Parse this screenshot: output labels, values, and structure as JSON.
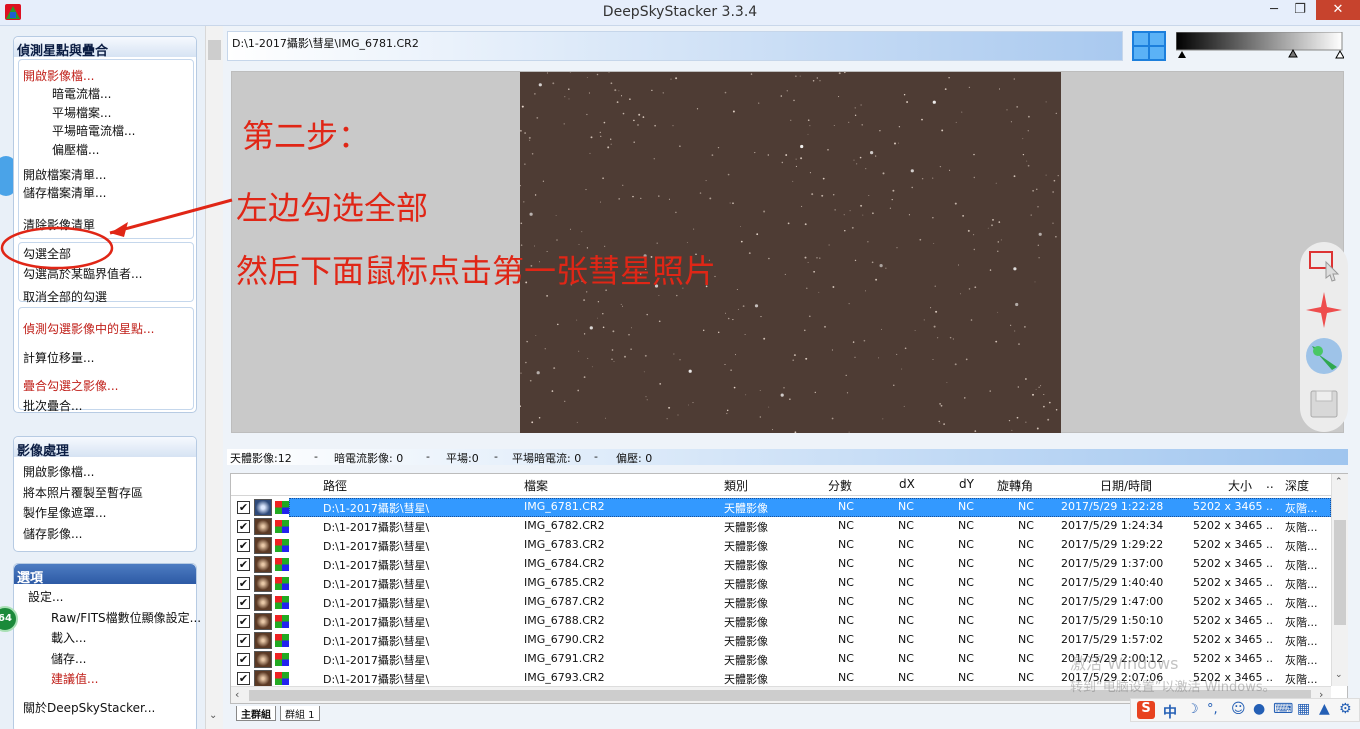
{
  "window": {
    "title": "DeepSkyStacker 3.3.4",
    "min": "─",
    "max": "❐",
    "close": "✕"
  },
  "left": {
    "group1": {
      "header": "偵測星點與疊合",
      "items": [
        {
          "label": "開啟影像檔...",
          "red": true
        },
        {
          "label": "暗電流檔..."
        },
        {
          "label": "平場檔案..."
        },
        {
          "label": "平場暗電流檔..."
        },
        {
          "label": "偏壓檔..."
        },
        {
          "label": "開啟檔案清單..."
        },
        {
          "label": "儲存檔案清單..."
        },
        {
          "label": "清除影像清單"
        },
        {
          "label": "勾選全部"
        },
        {
          "label": "勾選高於某臨界值者..."
        },
        {
          "label": "取消全部的勾選"
        },
        {
          "label": "偵測勾選影像中的星點...",
          "red": true
        },
        {
          "label": "計算位移量..."
        },
        {
          "label": "疊合勾選之影像...",
          "red": true
        },
        {
          "label": "批次疊合..."
        }
      ]
    },
    "group2": {
      "header": "影像處理",
      "items": [
        "開啟影像檔...",
        "將本照片覆製至暫存區",
        "製作星像遮罩...",
        "儲存影像..."
      ]
    },
    "group3": {
      "header": "選項",
      "items": [
        {
          "label": "設定..."
        },
        {
          "label": "Raw/FITS檔數位顯像設定..."
        },
        {
          "label": "載入..."
        },
        {
          "label": "儲存..."
        },
        {
          "label": "建議值...",
          "red": true
        },
        {
          "label": "關於DeepSkyStacker..."
        }
      ],
      "badge": "64"
    }
  },
  "viewer": {
    "path": "D:\\1-2017攝影\\彗星\\IMG_6781.CR2"
  },
  "annotations": {
    "step": "第二步：",
    "line1": "左边勾选全部",
    "line2": "然后下面鼠标点击第一张彗星照片"
  },
  "status": {
    "light": "天體影像:12",
    "dark": "暗電流影像: 0",
    "flat": "平場:0",
    "darkflat": "平場暗電流: 0",
    "bias": "偏壓: 0",
    "sep": "-"
  },
  "table": {
    "headers": {
      "path": "路徑",
      "file": "檔案",
      "type": "類別",
      "score": "分數",
      "dx": "dX",
      "dy": "dY",
      "angle": "旋轉角",
      "date": "日期/時間",
      "size": "大小",
      "cfa": "..",
      "depth": "深度"
    },
    "rows": [
      {
        "path": "D:\\1-2017攝影\\彗星\\",
        "file": "IMG_6781.CR2",
        "type": "天體影像",
        "score": "NC",
        "dx": "NC",
        "dy": "NC",
        "angle": "NC",
        "date": "2017/5/29 1:22:28",
        "size": "5202 x 3465",
        "cfa": "..",
        "depth": "灰階..."
      },
      {
        "path": "D:\\1-2017攝影\\彗星\\",
        "file": "IMG_6782.CR2",
        "type": "天體影像",
        "score": "NC",
        "dx": "NC",
        "dy": "NC",
        "angle": "NC",
        "date": "2017/5/29 1:24:34",
        "size": "5202 x 3465",
        "cfa": "..",
        "depth": "灰階..."
      },
      {
        "path": "D:\\1-2017攝影\\彗星\\",
        "file": "IMG_6783.CR2",
        "type": "天體影像",
        "score": "NC",
        "dx": "NC",
        "dy": "NC",
        "angle": "NC",
        "date": "2017/5/29 1:29:22",
        "size": "5202 x 3465",
        "cfa": "..",
        "depth": "灰階..."
      },
      {
        "path": "D:\\1-2017攝影\\彗星\\",
        "file": "IMG_6784.CR2",
        "type": "天體影像",
        "score": "NC",
        "dx": "NC",
        "dy": "NC",
        "angle": "NC",
        "date": "2017/5/29 1:37:00",
        "size": "5202 x 3465",
        "cfa": "..",
        "depth": "灰階..."
      },
      {
        "path": "D:\\1-2017攝影\\彗星\\",
        "file": "IMG_6785.CR2",
        "type": "天體影像",
        "score": "NC",
        "dx": "NC",
        "dy": "NC",
        "angle": "NC",
        "date": "2017/5/29 1:40:40",
        "size": "5202 x 3465",
        "cfa": "..",
        "depth": "灰階..."
      },
      {
        "path": "D:\\1-2017攝影\\彗星\\",
        "file": "IMG_6787.CR2",
        "type": "天體影像",
        "score": "NC",
        "dx": "NC",
        "dy": "NC",
        "angle": "NC",
        "date": "2017/5/29 1:47:00",
        "size": "5202 x 3465",
        "cfa": "..",
        "depth": "灰階..."
      },
      {
        "path": "D:\\1-2017攝影\\彗星\\",
        "file": "IMG_6788.CR2",
        "type": "天體影像",
        "score": "NC",
        "dx": "NC",
        "dy": "NC",
        "angle": "NC",
        "date": "2017/5/29 1:50:10",
        "size": "5202 x 3465",
        "cfa": "..",
        "depth": "灰階..."
      },
      {
        "path": "D:\\1-2017攝影\\彗星\\",
        "file": "IMG_6790.CR2",
        "type": "天體影像",
        "score": "NC",
        "dx": "NC",
        "dy": "NC",
        "angle": "NC",
        "date": "2017/5/29 1:57:02",
        "size": "5202 x 3465",
        "cfa": "..",
        "depth": "灰階..."
      },
      {
        "path": "D:\\1-2017攝影\\彗星\\",
        "file": "IMG_6791.CR2",
        "type": "天體影像",
        "score": "NC",
        "dx": "NC",
        "dy": "NC",
        "angle": "NC",
        "date": "2017/5/29 2:00:12",
        "size": "5202 x 3465",
        "cfa": "..",
        "depth": "灰階..."
      },
      {
        "path": "D:\\1-2017攝影\\彗星\\",
        "file": "IMG_6793.CR2",
        "type": "天體影像",
        "score": "NC",
        "dx": "NC",
        "dy": "NC",
        "angle": "NC",
        "date": "2017/5/29 2:07:06",
        "size": "5202 x 3465",
        "cfa": "..",
        "depth": "灰階..."
      }
    ],
    "tabs": [
      "主群組",
      "群組 1"
    ]
  },
  "watermark": {
    "line1": "激活 Windows",
    "line2": "转到“电脑设置”以激活 Windows。"
  },
  "ime": {
    "brand": "S",
    "lang": "中"
  },
  "colors": {
    "accent": "#3399ff",
    "annotation": "#e02616",
    "red_item": "#c0201a"
  }
}
